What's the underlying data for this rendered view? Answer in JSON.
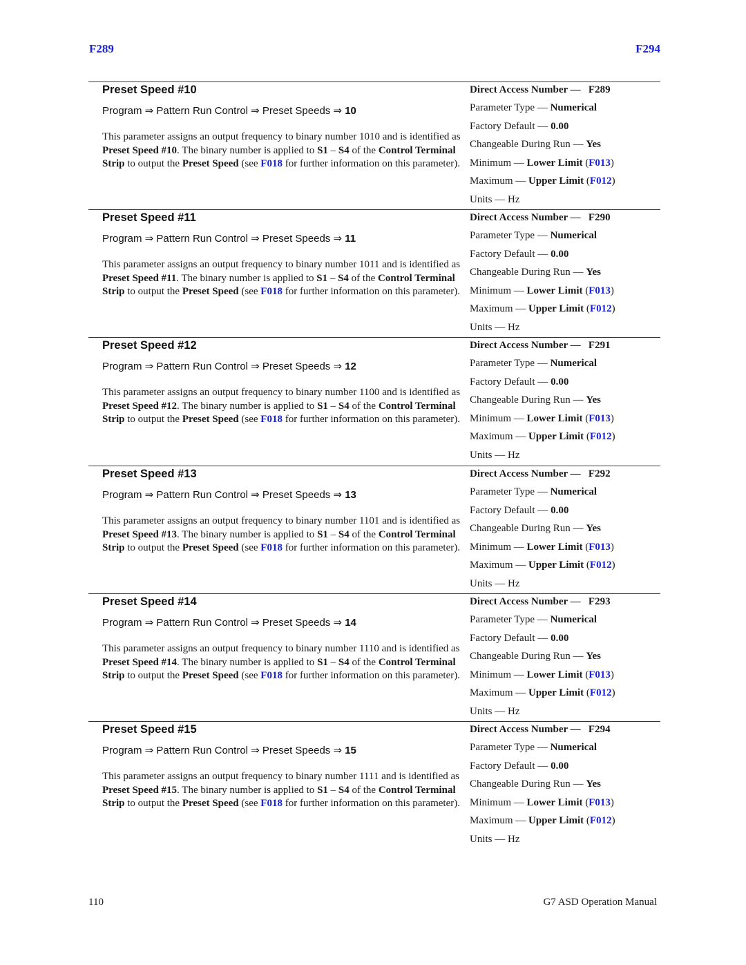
{
  "header": {
    "left": "F289",
    "right": "F294"
  },
  "common": {
    "path_prefix": "Program ⇒ Pattern Run Control ⇒ Preset Speeds ⇒",
    "desc_part1": "This parameter assigns an output frequency to binary number",
    "desc_part2": "and is identified as",
    "desc_part3": ". The binary number is applied to",
    "s1": "S1",
    "dash": "–",
    "s4": "S4",
    "desc_part4": "of the",
    "cts": "Control Terminal Strip",
    "desc_part5": "to output the",
    "preset_speed": "Preset Speed",
    "desc_part6": "(see",
    "desc_link": "F018",
    "desc_part7": "for further information on this parameter).",
    "dan_label": "Direct Access Number —",
    "ptype_label": "Parameter Type —",
    "ptype_value": "Numerical",
    "default_label": "Factory Default —",
    "default_value": "0.00",
    "changeable_label": "Changeable During Run —",
    "changeable_value": "Yes",
    "min_label": "Minimum —",
    "min_value": "Lower Limit",
    "min_link": "F013",
    "max_label": "Maximum —",
    "max_value": "Upper Limit",
    "max_link": "F012",
    "units_label": "Units —",
    "units_value": "Hz",
    "open_paren": "(",
    "close_paren": ")"
  },
  "sections": [
    {
      "title": "Preset Speed #10",
      "path_num": "10",
      "binary": "1010",
      "name": "Preset Speed #10",
      "dan": "F289"
    },
    {
      "title": "Preset Speed #11",
      "path_num": "11",
      "binary": "1011",
      "name": "Preset Speed #11",
      "dan": "F290"
    },
    {
      "title": "Preset Speed #12",
      "path_num": "12",
      "binary": "1100",
      "name": "Preset Speed #12",
      "dan": "F291"
    },
    {
      "title": "Preset Speed #13",
      "path_num": "13",
      "binary": "1101",
      "name": "Preset Speed #13",
      "dan": "F292"
    },
    {
      "title": "Preset Speed #14",
      "path_num": "14",
      "binary": "1110",
      "name": "Preset Speed #14",
      "dan": "F293"
    },
    {
      "title": "Preset Speed #15",
      "path_num": "15",
      "binary": "1111",
      "name": "Preset Speed #15",
      "dan": "F294"
    }
  ],
  "footer": {
    "page_number": "110",
    "manual_title": "G7 ASD Operation Manual"
  }
}
